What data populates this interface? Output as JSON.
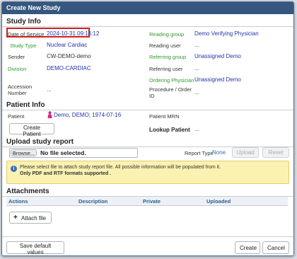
{
  "dialog": {
    "title": "Create New Study"
  },
  "study_info": {
    "header": "Study Info",
    "date_label": "Date of Service",
    "date_value": "2024-10-31 09:16:12",
    "type_label": "Study Type",
    "type_value": "Nuclear Cardiac",
    "sender_label": "Sender",
    "sender_value": "CW-DEMO-demo",
    "division_label": "Division",
    "division_value": "DEMO-CARDIAC",
    "accession_label_1": "Accession",
    "accession_label_2": "Number",
    "accession_value": "...",
    "reading_group_label": "Reading group",
    "reading_group_value": "Demo Verifying Physician",
    "reading_user_label": "Reading user",
    "reading_user_value": "...",
    "referring_group_label": "Referring group",
    "referring_group_value": "Unassigned Demo",
    "referring_user_label": "Referring user",
    "referring_user_value": "...",
    "ordering_physician_label": "Ordering Physician",
    "ordering_physician_value": "Unassigned Demo",
    "procedure_label_1": "Procedure / Order",
    "procedure_label_2": "ID",
    "procedure_value": "..."
  },
  "patient_info": {
    "header": "Patient Info",
    "patient_label": "Patient",
    "patient_value": "Demo, DEMO; 1974-07-16",
    "mrn_label": "Patient MRN",
    "create_button": "Create Patient",
    "lookup_label": "Lookup Patient",
    "lookup_value": "..."
  },
  "upload": {
    "header": "Upload study report",
    "browse_button": "Browse...",
    "file_status": "No file selected.",
    "report_type_label": "Report Type",
    "report_type_value": "None",
    "upload_button": "Upload",
    "reset_button": "Reset",
    "info_line1": "Please select file to attach study report file. All possible information will be populated from it.",
    "info_line2": "Only PDF and RTF formats supported ."
  },
  "attachments": {
    "header": "Attachments",
    "columns": [
      "Actions",
      "Description",
      "Private",
      "Uploaded"
    ],
    "attach_button": "Attach file"
  },
  "footer": {
    "save_defaults": "Save default values",
    "create": "Create",
    "cancel": "Cancel"
  },
  "colors": {
    "title_bar": "#35577f",
    "highlight_border": "#d01e1e",
    "link_blue": "#2233aa",
    "group_green": "#2e9a2e",
    "info_bg": "#fbf1b1"
  }
}
